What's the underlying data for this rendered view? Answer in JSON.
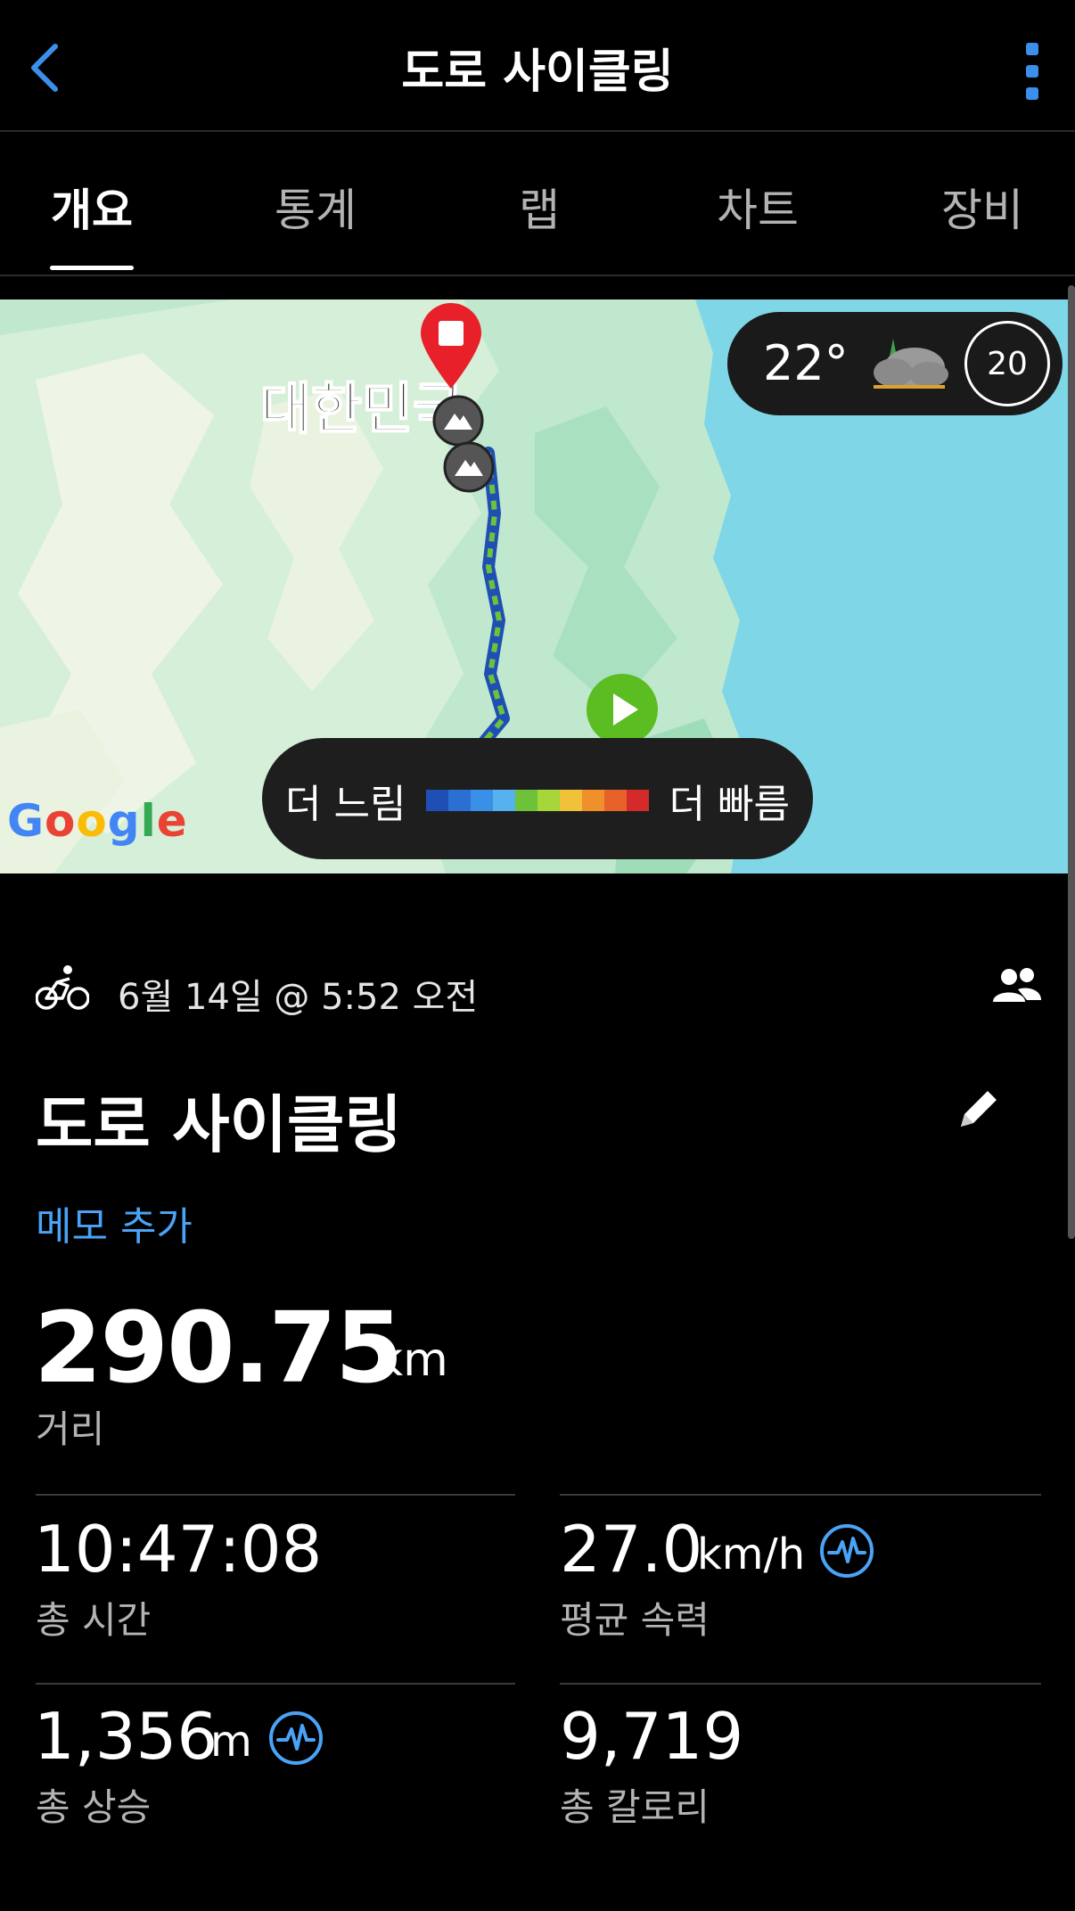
{
  "header": {
    "title": "도로 사이클링"
  },
  "tabs": [
    {
      "label": "개요",
      "active": true
    },
    {
      "label": "통계",
      "active": false
    },
    {
      "label": "랩",
      "active": false
    },
    {
      "label": "차트",
      "active": false
    },
    {
      "label": "장비",
      "active": false
    }
  ],
  "map": {
    "region_label": "대한민국",
    "weather": {
      "temperature": "22°",
      "wind": "20",
      "icon": "cloudy-icon"
    },
    "speed_legend": {
      "slower_label": "더 느림",
      "faster_label": "더 빠름",
      "colors": [
        "#1f4fb5",
        "#2a6fd1",
        "#3a8fe6",
        "#56b2ee",
        "#6ec23a",
        "#a6d63a",
        "#f0c23a",
        "#f0902a",
        "#e8602a",
        "#d42a2a"
      ]
    },
    "attribution": "Google"
  },
  "activity": {
    "date": "6월 14일 @ 5:52 오전",
    "title": "도로 사이클링",
    "memo_link": "메모 추가",
    "distance": {
      "value": "290.75",
      "unit": "km",
      "label": "거리"
    },
    "stats": [
      {
        "value": "10:47:08",
        "unit": "",
        "label": "총 시간",
        "has_icon": false
      },
      {
        "value": "27.0",
        "unit": "km/h",
        "label": "평균 속력",
        "has_icon": true
      },
      {
        "value": "1,356",
        "unit": "m",
        "label": "총 상승",
        "has_icon": true
      },
      {
        "value": "9,719",
        "unit": "",
        "label": "총 칼로리",
        "has_icon": false
      }
    ]
  },
  "colors": {
    "accent": "#3b8eea",
    "link": "#4aa3f7",
    "start_marker": "#5bbd22",
    "end_marker": "#e8202a"
  }
}
